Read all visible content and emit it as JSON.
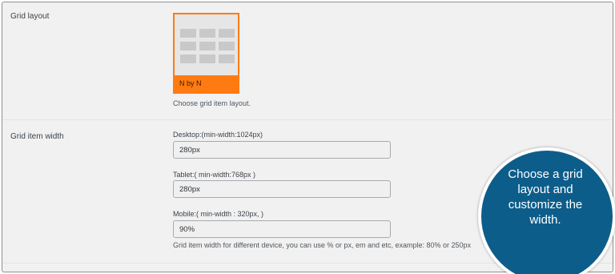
{
  "grid_layout": {
    "label": "Grid layout",
    "option_label": "N by N",
    "description": "Choose grid item layout.",
    "accent_color": "#ff7b12"
  },
  "grid_item_width": {
    "label": "Grid item width",
    "desktop": {
      "label": "Desktop:(min-width:1024px)",
      "value": "280px"
    },
    "tablet": {
      "label": "Tablet:( min-width:768px )",
      "value": "280px"
    },
    "mobile": {
      "label": "Mobile:( min-width : 320px, )",
      "value": "90%"
    },
    "help": "Grid item width for different device, you can use % or px, em and etc, example: 80% or 250px"
  },
  "callout": {
    "lines": [
      "Choose a grid",
      "layout and",
      "customize the",
      "width."
    ],
    "color": "#0d5d8a"
  }
}
